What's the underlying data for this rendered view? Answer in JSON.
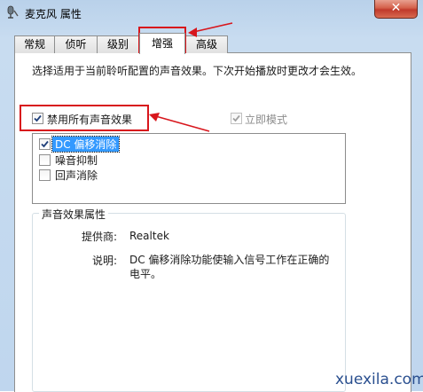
{
  "window": {
    "title": "麦克风 属性",
    "close_label": "✕"
  },
  "tabs": [
    {
      "label": "常规"
    },
    {
      "label": "侦听"
    },
    {
      "label": "级别"
    },
    {
      "label": "增强"
    },
    {
      "label": "高级"
    }
  ],
  "active_tab": "增强",
  "description": "选择适用于当前聆听配置的声音效果。下次开始播放时更改才会生效。",
  "disable_all": {
    "label": "禁用所有声音效果",
    "checked": true
  },
  "immediate_mode": {
    "label": "立即模式",
    "checked": true,
    "disabled": true
  },
  "effects": [
    {
      "label": "DC 偏移消除",
      "checked": true,
      "selected": true
    },
    {
      "label": "噪音抑制",
      "checked": false,
      "selected": false
    },
    {
      "label": "回声消除",
      "checked": false,
      "selected": false
    }
  ],
  "properties": {
    "group_title": "声音效果属性",
    "provider_label": "提供商:",
    "provider_value": "Realtek",
    "desc_label": "说明:",
    "desc_value_line1": "DC 偏移消除功能使输入信号工作在正确的",
    "desc_value_line2": "电平。"
  },
  "watermark": "xuexila.com",
  "colors": {
    "annotation_red": "#d8161c",
    "selection_blue": "#3399ff"
  }
}
